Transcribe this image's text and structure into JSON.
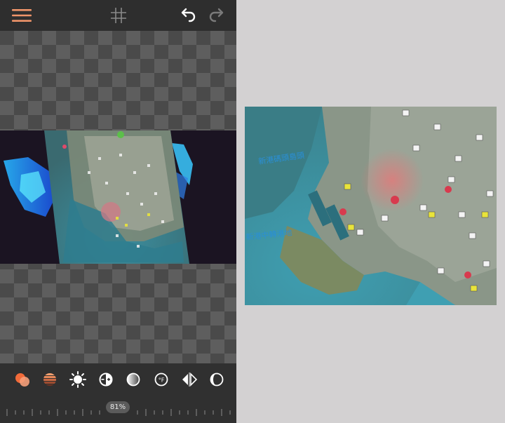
{
  "editor": {
    "toolbar_icons": [
      "menu-icon",
      "grid-icon",
      "undo-icon",
      "redo-icon"
    ],
    "adjust_tools": [
      "layers-icon",
      "gradient-icon",
      "brightness-icon",
      "contrast-icon",
      "saturation-icon",
      "temperature-icon",
      "flip-icon",
      "vibrance-icon"
    ],
    "zoom_label": "81%",
    "accent_color": "#f0956a"
  },
  "preview": {
    "map_labels": [
      "新港碼頭島頭",
      "新港中轉港地"
    ]
  }
}
